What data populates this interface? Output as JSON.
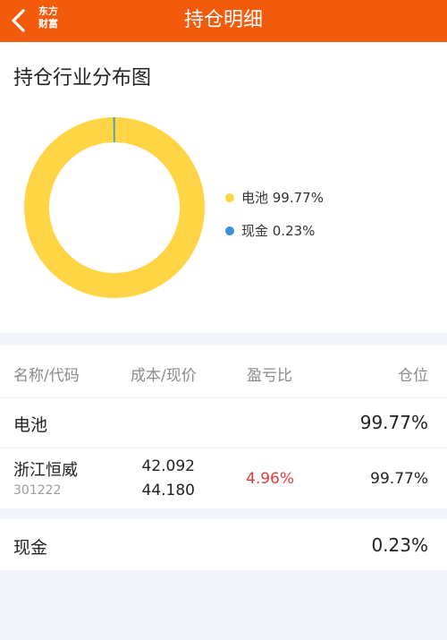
{
  "header": {
    "logo_line1": "东方",
    "logo_line2": "财富",
    "title": "持仓明细"
  },
  "chart": {
    "title": "持仓行业分布图",
    "legend": [
      {
        "label": "电池 99.77%",
        "color": "#ffd546"
      },
      {
        "label": "现金 0.23%",
        "color": "#3c8fd6"
      }
    ]
  },
  "chart_data": {
    "type": "pie",
    "title": "持仓行业分布图",
    "categories": [
      "电池",
      "现金"
    ],
    "values": [
      99.77,
      0.23
    ],
    "colors": [
      "#ffd546",
      "#3c8fd6"
    ],
    "donut": true,
    "legend_position": "right"
  },
  "table": {
    "headers": {
      "name": "名称/代码",
      "cost_price": "成本/现价",
      "pnl_ratio": "盈亏比",
      "position": "仓位"
    },
    "sector": {
      "name": "电池",
      "position": "99.77%"
    },
    "stock": {
      "name": "浙江恒威",
      "code": "301222",
      "cost": "42.092",
      "price": "44.180",
      "pnl": "4.96%",
      "position": "99.77%"
    }
  },
  "cash": {
    "name": "现金",
    "position": "0.23%"
  }
}
